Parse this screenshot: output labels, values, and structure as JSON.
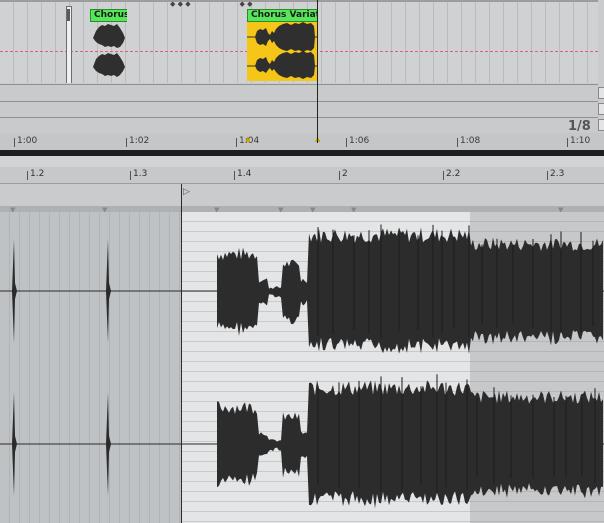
{
  "arrangement": {
    "clips": [
      {
        "label": "Chorus",
        "color": "#56e65a"
      },
      {
        "label": "Chorus Variation",
        "color": "#f5c518"
      }
    ],
    "ruler": [
      "1:00",
      "1:02",
      "1:04",
      "1:06",
      "1:08",
      "1:10"
    ],
    "quantization": "1/8"
  },
  "detail": {
    "ruler": [
      "1.2",
      "1.3",
      "1.4",
      "2",
      "2.2",
      "2.3"
    ]
  }
}
